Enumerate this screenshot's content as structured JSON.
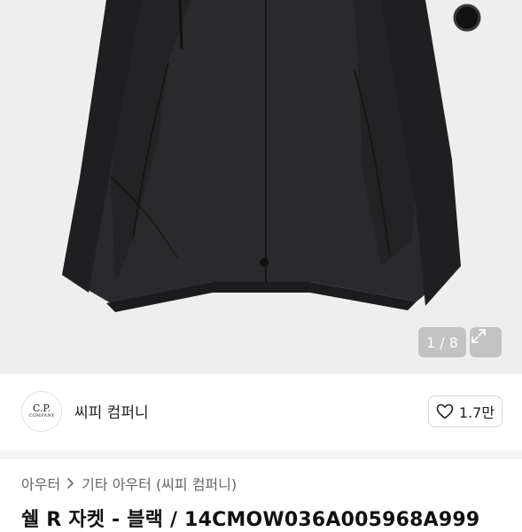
{
  "gallery": {
    "pager_text": "1 / 8",
    "expand_icon": "expand-icon",
    "background": "#eeeeee"
  },
  "brand": {
    "logo_line1": "C.P.",
    "logo_line2": "COMPANY",
    "name": "씨피 컴퍼니"
  },
  "like": {
    "icon": "heart-icon",
    "count": "1.7만"
  },
  "breadcrumb": {
    "level1": "아우터",
    "separator_icon": "chevron-right-icon",
    "level2": "기타 아우터 (씨피 컴퍼니)"
  },
  "product": {
    "title": "쉘 R 자켓 - 블랙 / 14CMOW036A005968A999"
  }
}
